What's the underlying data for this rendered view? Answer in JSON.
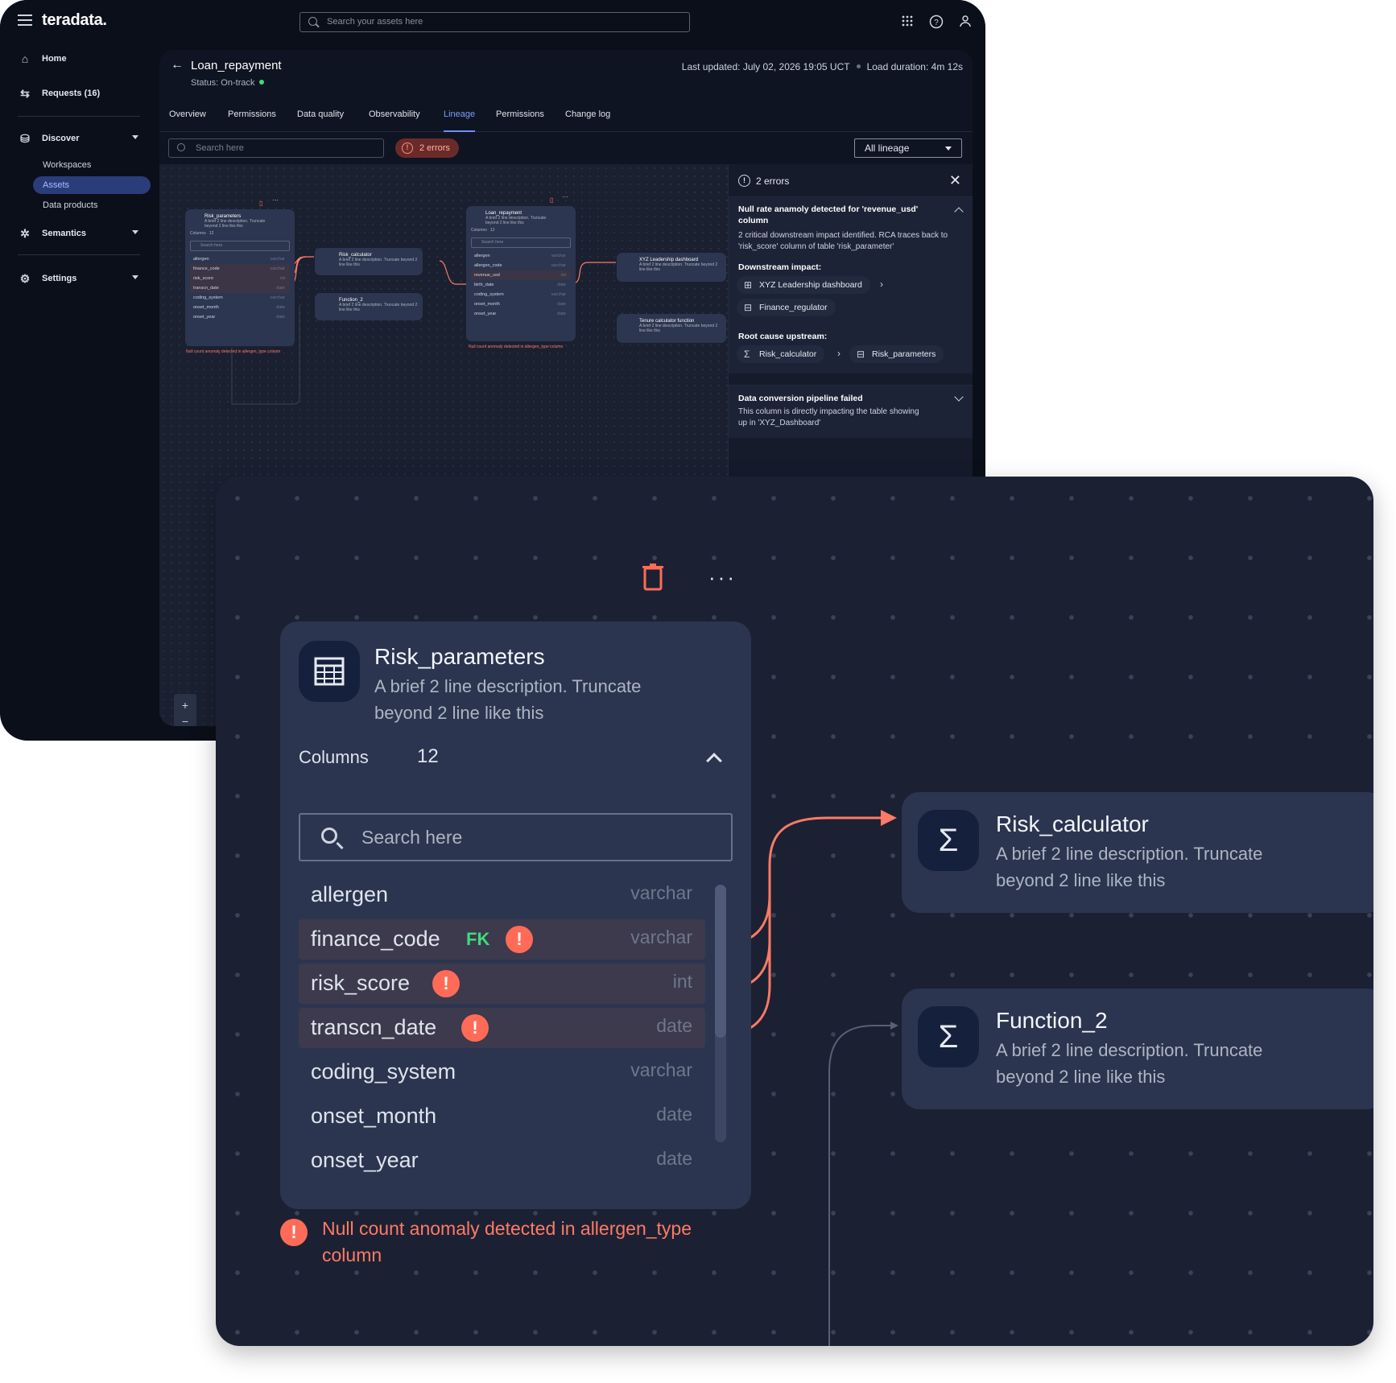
{
  "app": {
    "logo": "teradata.",
    "search_placeholder": "Search your assets here",
    "icons": [
      "menu-icon",
      "apps-grid-icon",
      "help-icon",
      "user-icon"
    ]
  },
  "sidebar": {
    "home": "Home",
    "requests": "Requests (16)",
    "discover": "Discover",
    "discover_items": [
      "Workspaces",
      "Assets",
      "Data products"
    ],
    "semantics": "Semantics",
    "settings": "Settings"
  },
  "header": {
    "title": "Loan_repayment",
    "status": "Status: On-track",
    "last_updated": "Last updated: July 02, 2026 19:05 UCT",
    "load_duration": "Load duration: 4m 12s"
  },
  "tabs": [
    "Overview",
    "Permissions",
    "Data quality",
    "Observability",
    "Lineage",
    "Permissions",
    "Change log"
  ],
  "active_tab": "Lineage",
  "toolbar": {
    "search_placeholder": "Search here",
    "errors_badge": "2 errors",
    "lineage_select": "All lineage"
  },
  "minimap": {
    "risk_parameters": {
      "name": "Risk_parameters",
      "desc": "A brief 2 line description. Truncate beyond 2 line like this",
      "columns_label": "Columns",
      "columns_count": "12",
      "search": "Search here",
      "rows": [
        {
          "name": "allergen",
          "type": "varchar"
        },
        {
          "name": "finance_code",
          "type": "varchar"
        },
        {
          "name": "risk_score",
          "type": "int"
        },
        {
          "name": "transcn_date",
          "type": "date"
        },
        {
          "name": "coding_system",
          "type": "varchar"
        },
        {
          "name": "onset_month",
          "type": "date"
        },
        {
          "name": "onset_year",
          "type": "date"
        }
      ],
      "error": "Null count anomaly detected in allergen_type column"
    },
    "risk_calculator": {
      "name": "Risk_calculator",
      "desc": "A brief 2 line description. Truncate beyond 2 line like this"
    },
    "function_2": {
      "name": "Function_2",
      "desc": "A brief 2 line description. Truncate beyond 2 line like this"
    },
    "loan_repayment": {
      "name": "Loan_repayment",
      "desc": "A brief 2 line description. Truncate beyond 2 line like this",
      "columns_label": "Columns",
      "columns_count": "12",
      "search": "Search here",
      "rows": [
        {
          "name": "allergen",
          "type": "varchar"
        },
        {
          "name": "allergen_code",
          "type": "varchar"
        },
        {
          "name": "revenue_usd",
          "type": "int"
        },
        {
          "name": "birth_date",
          "type": "date"
        },
        {
          "name": "coding_system",
          "type": "varchar"
        },
        {
          "name": "onset_month",
          "type": "date"
        },
        {
          "name": "onset_year",
          "type": "date"
        }
      ],
      "error": "Null count anomaly detected in allergen_type column"
    },
    "xyz_dashboard": {
      "name": "XYZ Leadership dashboard",
      "desc": "A brief 2 line description. Truncate beyond 2 line like this"
    },
    "tenure_function": {
      "name": "Tenure calculator function",
      "desc": "A brief 2 line description. Truncate beyond 2 line like this"
    }
  },
  "zoom_controls": [
    "+",
    "−"
  ],
  "error_panel": {
    "title": "2 errors",
    "error1": {
      "title": "Null rate anamoly detected for 'revenue_usd' column",
      "body": "2 critical downstream impact identified. RCA traces back to 'risk_score' column of table 'risk_parameter'",
      "downstream_label": "Downstream impact:",
      "downstream": [
        "XYZ Leadership dashboard",
        "Finance_regulator"
      ],
      "root_label": "Root cause upstream:",
      "root": [
        "Risk_calculator",
        "Risk_parameters"
      ]
    },
    "error2": {
      "title": "Data conversion pipeline failed",
      "body": "This column is directly impacting the table showing up in 'XYZ_Dashboard'"
    }
  },
  "zoomed": {
    "node": {
      "name": "Risk_parameters",
      "desc_line1": "A brief 2 line description. Truncate",
      "desc_line2": "beyond 2 line like this",
      "columns_label": "Columns",
      "columns_count": "12",
      "search_placeholder": "Search here",
      "fk_label": "FK",
      "rows": [
        {
          "name": "allergen",
          "type": "varchar"
        },
        {
          "name": "finance_code",
          "type": "varchar"
        },
        {
          "name": "risk_score",
          "type": "int"
        },
        {
          "name": "transcn_date",
          "type": "date"
        },
        {
          "name": "coding_system",
          "type": "varchar"
        },
        {
          "name": "onset_month",
          "type": "date"
        },
        {
          "name": "onset_year",
          "type": "date"
        }
      ],
      "error_line1": "Null count anomaly detected in allergen_type",
      "error_line2": "column"
    },
    "risk_calculator": {
      "name": "Risk_calculator",
      "desc_line1": "A brief 2 line description. Truncate",
      "desc_line2": "beyond 2 line like this"
    },
    "function_2": {
      "name": "Function_2",
      "desc_line1": "A brief 2 line description. Truncate",
      "desc_line2": "beyond 2 line like this"
    }
  },
  "colors": {
    "accent": "#6f8fff",
    "error": "#ff6b57",
    "fk": "#3ddc7a",
    "status_ok": "#3ddc7a"
  }
}
